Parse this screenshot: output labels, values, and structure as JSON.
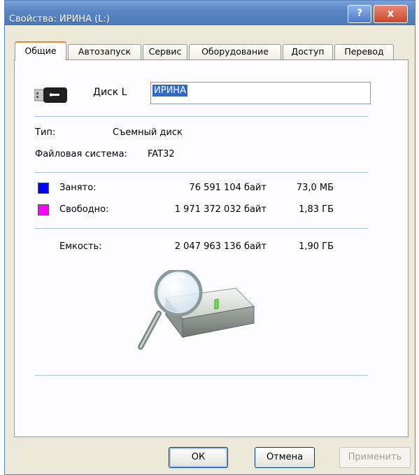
{
  "window": {
    "title": "Свойства: ИРИНА (L:)",
    "help_label": "?",
    "close_label": "x"
  },
  "tabs": [
    {
      "label": "Общие",
      "active": true
    },
    {
      "label": "Автозапуск"
    },
    {
      "label": "Сервис"
    },
    {
      "label": "Оборудование"
    },
    {
      "label": "Доступ"
    },
    {
      "label": "Перевод"
    }
  ],
  "general": {
    "disk_label": "Диск L",
    "name_value": "ИРИНА",
    "type_label": "Тип:",
    "type_value": "Съемный диск",
    "fs_label": "Файловая система:",
    "fs_value": "FAT32",
    "used": {
      "label": "Занято:",
      "bytes": "76 591 104 байт",
      "size": "73,0 МБ",
      "color": "#0000ff"
    },
    "free": {
      "label": "Свободно:",
      "bytes": "1 971 372 032 байт",
      "size": "1,83 ГБ",
      "color": "#ff00ff"
    },
    "capacity": {
      "label": "Емкость:",
      "bytes": "2 047 963 136 байт",
      "size": "1,90 ГБ"
    },
    "icons": {
      "device": "usb-drive-icon",
      "illustration": "drive-search-icon"
    }
  },
  "buttons": {
    "ok": "ОК",
    "cancel": "Отмена",
    "apply": "Применить"
  }
}
